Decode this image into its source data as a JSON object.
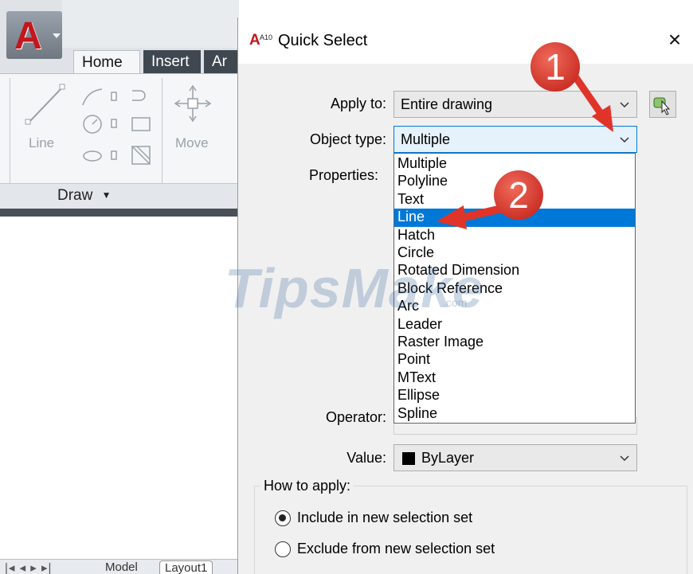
{
  "ribbon": {
    "tabs": [
      "Home",
      "Insert",
      "Annotate"
    ],
    "tab_visible_text": [
      "Home",
      "Insert",
      "Ar"
    ],
    "tools": {
      "line": "Line",
      "move": "Move"
    },
    "panel_label": "Draw"
  },
  "layout_tabs": {
    "model": "Model",
    "layout1": "Layout1"
  },
  "dialog": {
    "app_icon_text": "A10",
    "title": "Quick Select",
    "close_label": "×",
    "apply_to_label": "Apply to:",
    "apply_to_value": "Entire drawing",
    "object_type_label": "Object type:",
    "object_type_value": "Multiple",
    "properties_label": "Properties:",
    "operator_label": "Operator:",
    "value_label": "Value:",
    "value_value": "ByLayer",
    "value_swatch_color": "#000000",
    "object_type_options": [
      "Multiple",
      "Polyline",
      "Text",
      "Line",
      "Hatch",
      "Circle",
      "Rotated Dimension",
      "Block Reference",
      "Arc",
      "Leader",
      "Raster Image",
      "Point",
      "MText",
      "Ellipse",
      "Spline"
    ],
    "highlighted_option": "Line",
    "how_to_apply_label": "How to apply:",
    "radio_include": "Include in new selection set",
    "radio_exclude": "Exclude from new selection set",
    "radio_include_checked": true
  },
  "overlays": {
    "watermark": "TipsMake",
    "watermark_suffix": ".com",
    "step_badges": [
      "1",
      "2"
    ],
    "annotation_color": "#e0342a"
  }
}
